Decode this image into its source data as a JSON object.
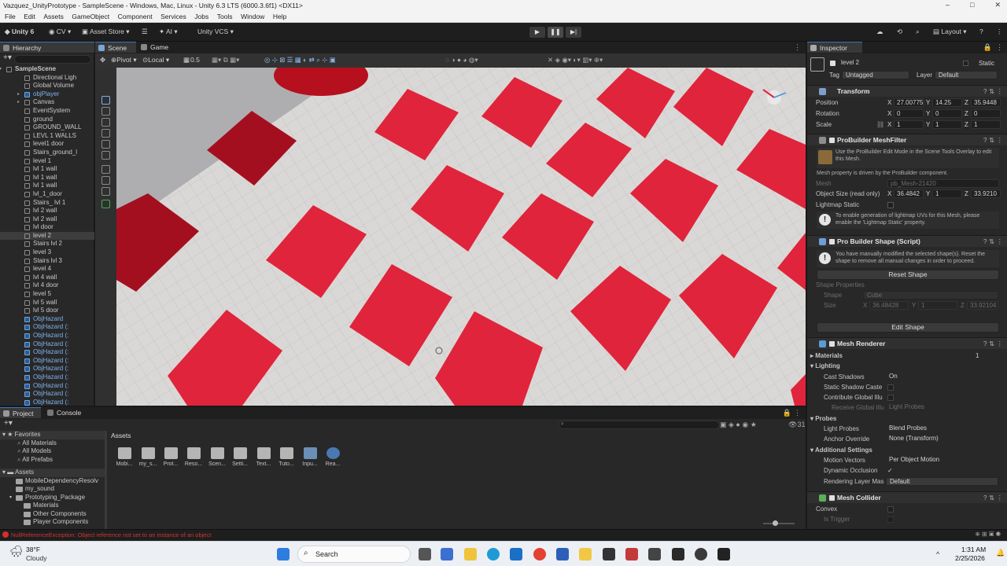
{
  "window": {
    "title": "Vazquez_UnityPrototype - SampleScene - Windows, Mac, Linux - Unity 6.3 LTS (6000.3.6f1) <DX11>",
    "controls": [
      "–",
      "□",
      "✕"
    ]
  },
  "menu": [
    "File",
    "Edit",
    "Assets",
    "GameObject",
    "Component",
    "Services",
    "Jobs",
    "Tools",
    "Window",
    "Help"
  ],
  "toolbar": {
    "account": "Unity 6",
    "cv": "CV",
    "asset_store": "Asset Store",
    "ai": "AI",
    "vcs": "Unity VCS",
    "layout": "Layout",
    "play_icons": [
      "▶",
      "❚❚",
      "▶|"
    ]
  },
  "hierarchy": {
    "tab": "Hierarchy",
    "items": [
      {
        "label": "SampleScene",
        "depth": 0,
        "type": "scene"
      },
      {
        "label": "Directional Ligh",
        "depth": 1
      },
      {
        "label": "Global Volume",
        "depth": 1
      },
      {
        "label": "objPlayer",
        "depth": 1,
        "blue": true,
        "arrow": true
      },
      {
        "label": "Canvas",
        "depth": 1,
        "arrow": true
      },
      {
        "label": "EventSystem",
        "depth": 1
      },
      {
        "label": "ground",
        "depth": 1
      },
      {
        "label": "GROUND_WALL",
        "depth": 1
      },
      {
        "label": "LEVL 1 WALLS",
        "depth": 1
      },
      {
        "label": "level1 door",
        "depth": 1
      },
      {
        "label": "Stairs_ground_l",
        "depth": 1
      },
      {
        "label": "level 1",
        "depth": 1
      },
      {
        "label": "lvl 1 wall",
        "depth": 1
      },
      {
        "label": "lvl 1 wall",
        "depth": 1
      },
      {
        "label": "lvl 1 wall",
        "depth": 1
      },
      {
        "label": "lvl_1_door",
        "depth": 1
      },
      {
        "label": "Stairs_ lvl 1",
        "depth": 1
      },
      {
        "label": "lvl 2 wall",
        "depth": 1
      },
      {
        "label": "lvl 2 wall",
        "depth": 1
      },
      {
        "label": "lvl door",
        "depth": 1
      },
      {
        "label": "level 2",
        "depth": 1,
        "selected": true
      },
      {
        "label": "Stairs lvl 2",
        "depth": 1
      },
      {
        "label": "level 3",
        "depth": 1
      },
      {
        "label": "Stairs lvl 3",
        "depth": 1
      },
      {
        "label": "level 4",
        "depth": 1
      },
      {
        "label": "lvl 4 wall",
        "depth": 1
      },
      {
        "label": "lvl 4 door",
        "depth": 1
      },
      {
        "label": "level 5",
        "depth": 1
      },
      {
        "label": "lvl 5 wall",
        "depth": 1
      },
      {
        "label": "lvl 5 door",
        "depth": 1
      },
      {
        "label": "ObjHazard",
        "depth": 1,
        "blue": true
      },
      {
        "label": "ObjHazard (:",
        "depth": 1,
        "blue": true
      },
      {
        "label": "ObjHazard (:",
        "depth": 1,
        "blue": true
      },
      {
        "label": "ObjHazard (:",
        "depth": 1,
        "blue": true
      },
      {
        "label": "ObjHazard (:",
        "depth": 1,
        "blue": true
      },
      {
        "label": "ObjHazard (:",
        "depth": 1,
        "blue": true
      },
      {
        "label": "ObjHazard (:",
        "depth": 1,
        "blue": true
      },
      {
        "label": "ObjHazard (:",
        "depth": 1,
        "blue": true
      },
      {
        "label": "ObjHazard (:",
        "depth": 1,
        "blue": true
      },
      {
        "label": "ObjHazard (:",
        "depth": 1,
        "blue": true
      },
      {
        "label": "ObjHazard (:",
        "depth": 1,
        "blue": true
      }
    ]
  },
  "scene": {
    "tabs": [
      "Scene",
      "Game"
    ],
    "pivot": "Pivot",
    "local": "Local",
    "snap": "0.5",
    "colors": {
      "tile": "#e0243b",
      "tile_dark": "#9c0e1e",
      "floor": "#d9d7d5"
    }
  },
  "inspector": {
    "tab": "Inspector",
    "object_name": "level 2",
    "static_label": "Static",
    "tag_label": "Tag",
    "tag_value": "Untagged",
    "layer_label": "Layer",
    "layer_value": "Default",
    "transform": {
      "title": "Transform",
      "position": {
        "label": "Position",
        "x": "27.00775",
        "y": "14.25",
        "z": "35.9448"
      },
      "rotation": {
        "label": "Rotation",
        "x": "0",
        "y": "0",
        "z": "0"
      },
      "scale": {
        "label": "Scale",
        "x": "1",
        "y": "1",
        "z": "1"
      }
    },
    "meshfilter": {
      "title": "ProBuilder MeshFilter",
      "help": "Use the ProBuilder Edit Mode in the Scene Tools Overlay to edit this Mesh.",
      "note": "Mesh property is driven by the ProBuilder component.",
      "mesh_label": "Mesh",
      "mesh_value": "pb_Mesh-21420",
      "size_label": "Object Size (read only)",
      "size_x": "36.4842",
      "size_y": "1",
      "size_z": "33.9210",
      "lightmap_label": "Lightmap Static",
      "warn": "To enable generation of lightmap UVs for this Mesh, please enable the 'Lightmap Static' property."
    },
    "shape": {
      "title": "Pro Builder Shape (Script)",
      "warn": "You have manually modified the selected shape(s). Reset the shape to remove all manual changes in order to proceed.",
      "reset": "Reset Shape",
      "props_label": "Shape Properties",
      "shape_label": "Shape",
      "shape_value": "Cube",
      "size_label": "Size",
      "size_x": "36.48428",
      "size_y": "1",
      "size_z": "33.92104",
      "edit": "Edit Shape"
    },
    "renderer": {
      "title": "Mesh Renderer",
      "materials": "Materials",
      "materials_count": "1",
      "lighting": "Lighting",
      "cast_shadows": "Cast Shadows",
      "cast_shadows_value": "On",
      "static_shadow": "Static Shadow Caste",
      "contribute": "Contribute Global Illu",
      "receive": "Receive Global Illu",
      "receive_value": "Light Probes",
      "probes": "Probes",
      "light_probes": "Light Probes",
      "light_probes_value": "Blend Probes",
      "anchor": "Anchor Override",
      "anchor_value": "None (Transform)",
      "additional": "Additional Settings",
      "motion": "Motion Vectors",
      "motion_value": "Per Object Motion",
      "dynamic": "Dynamic Occlusion",
      "dynamic_check": "✓",
      "layer_mask": "Rendering Layer Mas",
      "layer_mask_value": "Default"
    },
    "collider": {
      "title": "Mesh Collider",
      "convex": "Convex",
      "trigger": "Is Trigger"
    }
  },
  "project": {
    "tabs": [
      "Project",
      "Console"
    ],
    "favorites": "Favorites",
    "fav_items": [
      "All Materials",
      "All Models",
      "All Prefabs"
    ],
    "assets_root": "Assets",
    "tree": [
      "MobileDependencyResolv",
      "my_sound",
      "Prototyping_Package",
      "Materials",
      "Other Components",
      "Player Components"
    ],
    "breadcrumb": "Assets",
    "assets": [
      "Mobi...",
      "my_s...",
      "Prot...",
      "Reso...",
      "Scen...",
      "Setti...",
      "Text...",
      "Tuto...",
      "Inpu...",
      "Rea..."
    ],
    "count": "31"
  },
  "status": {
    "error": "NullReferenceException: Object reference not set to an instance of an object"
  },
  "taskbar": {
    "temp": "38°F",
    "weather": "Cloudy",
    "search": "Search",
    "time": "1:31 AM",
    "date": "2/25/2026"
  }
}
